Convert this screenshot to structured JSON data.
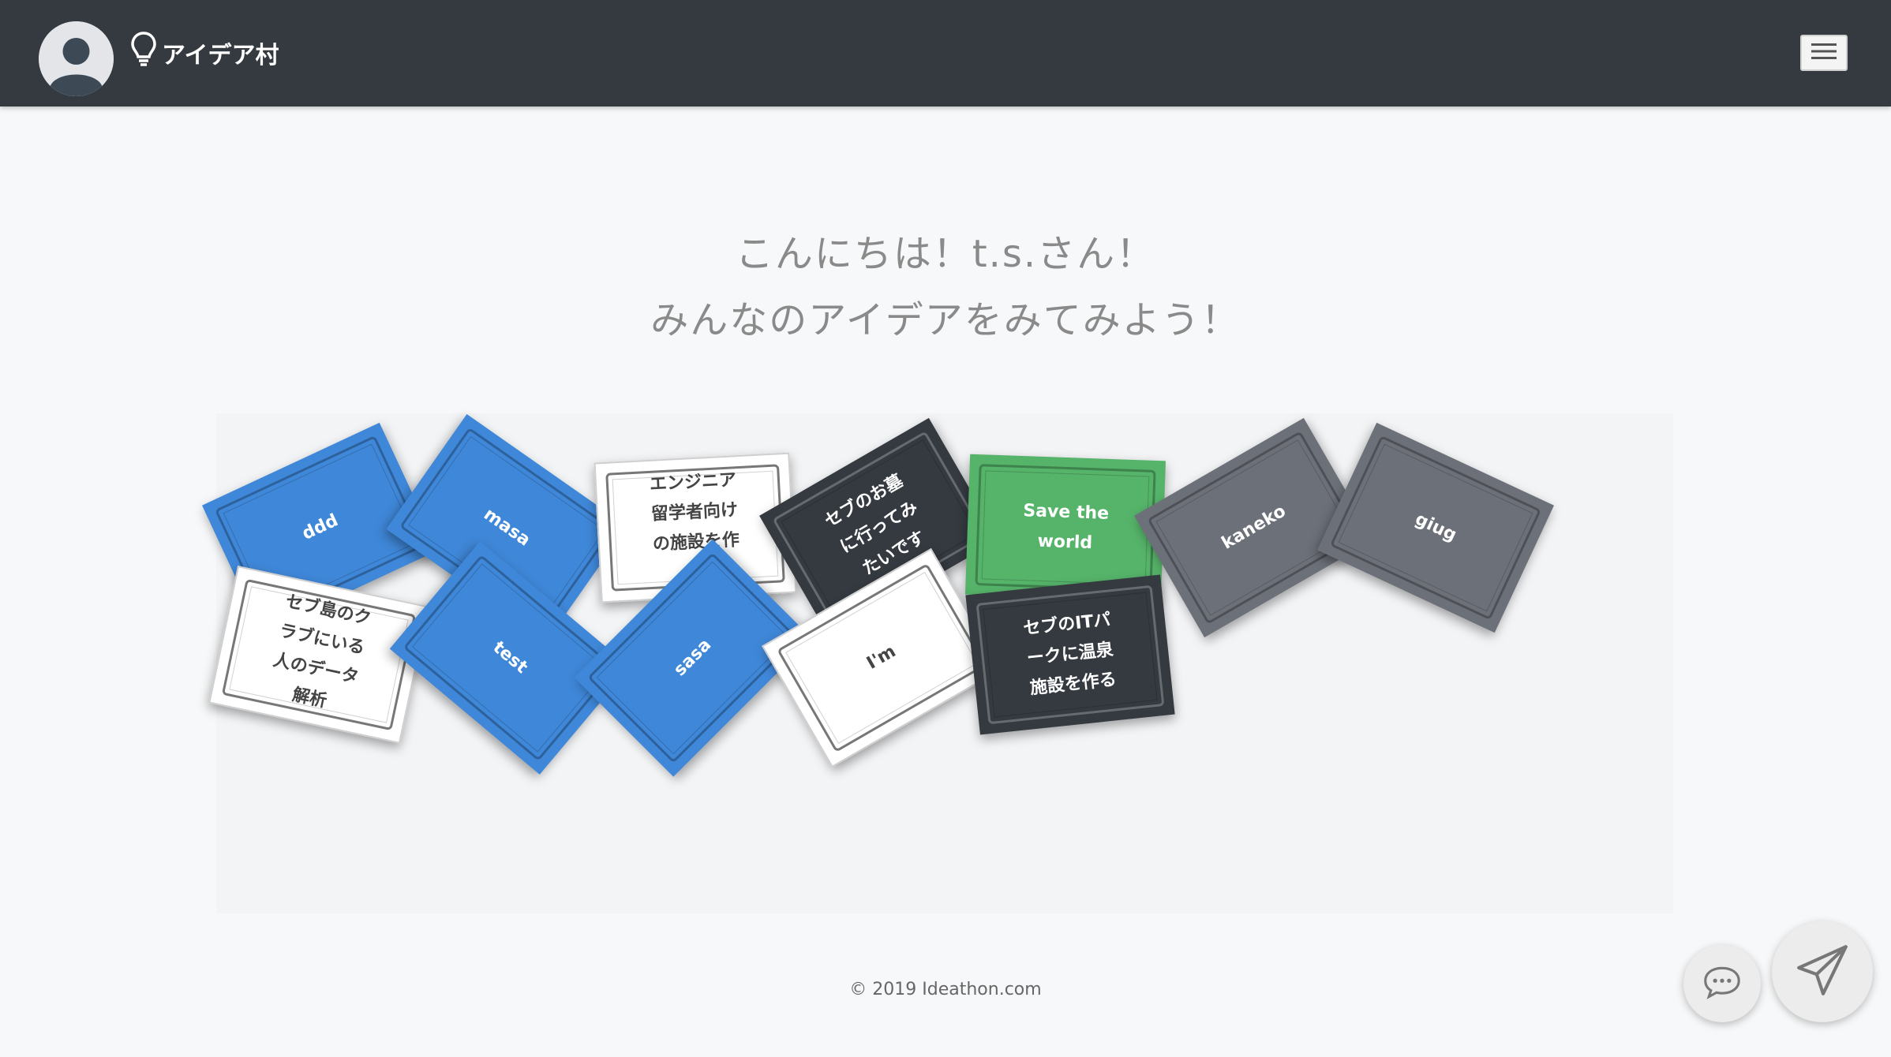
{
  "app": {
    "brand": "アイデア村"
  },
  "icons": {
    "avatar": "user-avatar-icon",
    "brand": "lightbulb-icon",
    "menu": "hamburger-icon",
    "chat": "chat-bubble-icon",
    "send": "paper-plane-icon"
  },
  "greeting": {
    "line1": "こんにちは！t.s.さん！",
    "line2": "みんなのアイデアをみてみよう！"
  },
  "cards": [
    {
      "label": "ddd",
      "style": "blue"
    },
    {
      "label": "masa",
      "style": "blue"
    },
    {
      "label": "エンジニア\n留学者向け\nの施設を作\nる",
      "style": "white"
    },
    {
      "label": "セブのお墓\nに行ってみ\nたいです",
      "style": "dark"
    },
    {
      "label": "Save the\nworld",
      "style": "green"
    },
    {
      "label": "kaneko",
      "style": "gray"
    },
    {
      "label": "giug",
      "style": "gray"
    },
    {
      "label": "セブ島のク\nラブにいる\n人のデータ\n解析",
      "style": "white"
    },
    {
      "label": "test",
      "style": "blue"
    },
    {
      "label": "sasa",
      "style": "blue"
    },
    {
      "label": "I'm",
      "style": "white"
    },
    {
      "label": "セブのITパ\nークに温泉\n施設を作る",
      "style": "dark"
    }
  ],
  "footer": {
    "copyright": "© 2019 Ideathon.com"
  },
  "colors": {
    "navbar": "#343a40",
    "blue_card": "#3f87d8",
    "green_card": "#56b46a",
    "gray_card": "#6c7078",
    "dark_card": "#343a40"
  }
}
